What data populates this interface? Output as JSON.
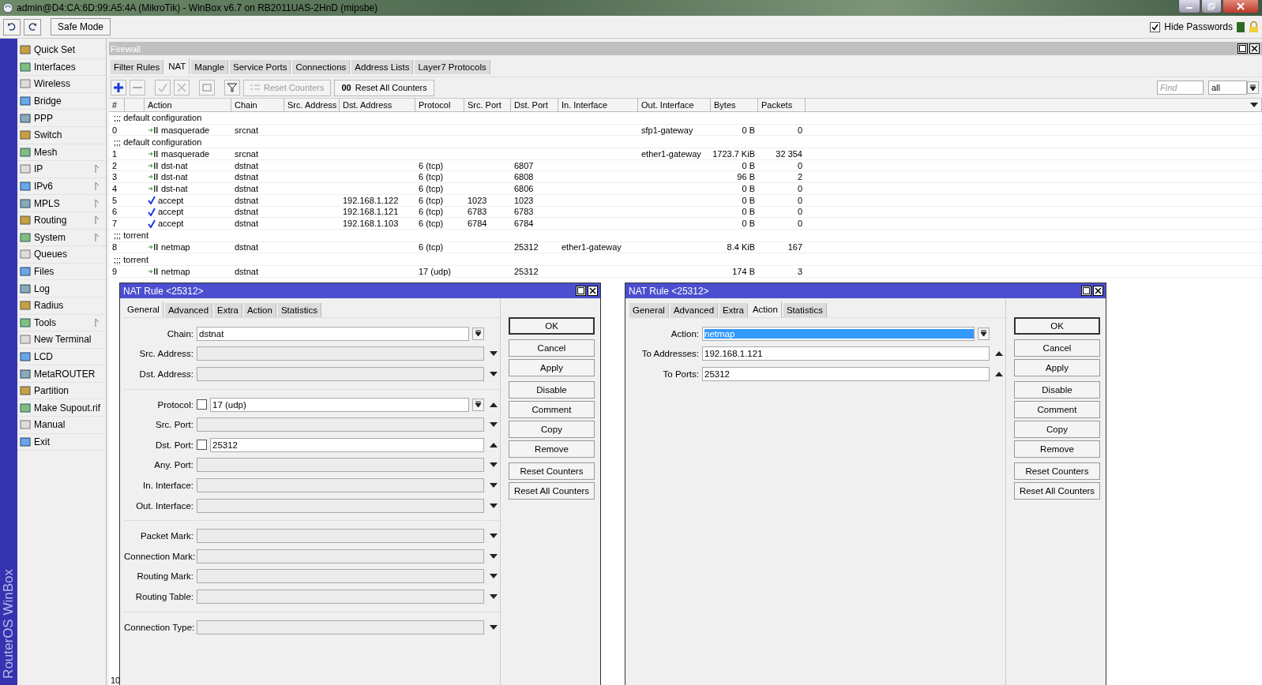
{
  "window": {
    "title": "admin@D4:CA:6D:99:A5:4A (MikroTik) - WinBox v6.7 on RB2011UAS-2HnD (mipsbe)"
  },
  "toolbar": {
    "safe_mode": "Safe Mode",
    "hide_passwords": {
      "label": "Hide Passwords",
      "checked": true
    }
  },
  "brand": "RouterOS WinBox",
  "sidebar": {
    "items": [
      {
        "label": "Quick Set",
        "submenu": false
      },
      {
        "label": "Interfaces",
        "submenu": false
      },
      {
        "label": "Wireless",
        "submenu": false
      },
      {
        "label": "Bridge",
        "submenu": false
      },
      {
        "label": "PPP",
        "submenu": false
      },
      {
        "label": "Switch",
        "submenu": false
      },
      {
        "label": "Mesh",
        "submenu": false
      },
      {
        "label": "IP",
        "submenu": true
      },
      {
        "label": "IPv6",
        "submenu": true
      },
      {
        "label": "MPLS",
        "submenu": true
      },
      {
        "label": "Routing",
        "submenu": true
      },
      {
        "label": "System",
        "submenu": true
      },
      {
        "label": "Queues",
        "submenu": false
      },
      {
        "label": "Files",
        "submenu": false
      },
      {
        "label": "Log",
        "submenu": false
      },
      {
        "label": "Radius",
        "submenu": false
      },
      {
        "label": "Tools",
        "submenu": true
      },
      {
        "label": "New Terminal",
        "submenu": false
      },
      {
        "label": "LCD",
        "submenu": false
      },
      {
        "label": "MetaROUTER",
        "submenu": false
      },
      {
        "label": "Partition",
        "submenu": false
      },
      {
        "label": "Make Supout.rif",
        "submenu": false
      },
      {
        "label": "Manual",
        "submenu": false
      },
      {
        "label": "Exit",
        "submenu": false
      }
    ]
  },
  "firewall": {
    "title": "Firewall",
    "tabs": [
      {
        "label": "Filter Rules",
        "selected": false
      },
      {
        "label": "NAT",
        "selected": true
      },
      {
        "label": "Mangle",
        "selected": false
      },
      {
        "label": "Service Ports",
        "selected": false
      },
      {
        "label": "Connections",
        "selected": false
      },
      {
        "label": "Address Lists",
        "selected": false
      },
      {
        "label": "Layer7 Protocols",
        "selected": false
      }
    ],
    "reset_counters": {
      "label": "Reset Counters",
      "disabled": true
    },
    "reset_all_counters": {
      "glyph": "00",
      "label": "Reset All Counters"
    },
    "find": {
      "placeholder": "Find"
    },
    "filter": {
      "value": "all"
    },
    "table": {
      "columns": [
        "#",
        "Action",
        "Chain",
        "Src. Address",
        "Dst. Address",
        "Protocol",
        "Src. Port",
        "Dst. Port",
        "In. Interface",
        "Out. Interface",
        "Bytes",
        "Packets"
      ],
      "rows": [
        {
          "kind": "comment",
          "text": ";;; default configuration"
        },
        {
          "kind": "rule",
          "number": "0",
          "action": "masquerade",
          "chain": "srcnat",
          "out_interface": "sfp1-gateway",
          "bytes": "0 B",
          "packets": "0"
        },
        {
          "kind": "comment",
          "text": ";;; default configuration"
        },
        {
          "kind": "rule",
          "number": "1",
          "action": "masquerade",
          "chain": "srcnat",
          "out_interface": "ether1-gateway",
          "bytes": "1723.7 KiB",
          "packets": "32 354"
        },
        {
          "kind": "rule",
          "number": "2",
          "action": "dst-nat",
          "chain": "dstnat",
          "protocol": "6 (tcp)",
          "dst_port": "6807",
          "bytes": "0 B",
          "packets": "0"
        },
        {
          "kind": "rule",
          "number": "3",
          "action": "dst-nat",
          "chain": "dstnat",
          "protocol": "6 (tcp)",
          "dst_port": "6808",
          "bytes": "96 B",
          "packets": "2"
        },
        {
          "kind": "rule",
          "number": "4",
          "action": "dst-nat",
          "chain": "dstnat",
          "protocol": "6 (tcp)",
          "dst_port": "6806",
          "bytes": "0 B",
          "packets": "0"
        },
        {
          "kind": "accept",
          "number": "5",
          "action": "accept",
          "chain": "dstnat",
          "dst_address": "192.168.1.122",
          "protocol": "6 (tcp)",
          "src_port": "1023",
          "dst_port": "1023",
          "bytes": "0 B",
          "packets": "0"
        },
        {
          "kind": "accept",
          "number": "6",
          "action": "accept",
          "chain": "dstnat",
          "dst_address": "192.168.1.121",
          "protocol": "6 (tcp)",
          "src_port": "6783",
          "dst_port": "6783",
          "bytes": "0 B",
          "packets": "0"
        },
        {
          "kind": "accept",
          "number": "7",
          "action": "accept",
          "chain": "dstnat",
          "dst_address": "192.168.1.103",
          "protocol": "6 (tcp)",
          "src_port": "6784",
          "dst_port": "6784",
          "bytes": "0 B",
          "packets": "0"
        },
        {
          "kind": "comment",
          "text": ";;; torrent"
        },
        {
          "kind": "rule",
          "number": "8",
          "action": "netmap",
          "chain": "dstnat",
          "protocol": "6 (tcp)",
          "dst_port": "25312",
          "in_interface": "ether1-gateway",
          "bytes": "8.4 KiB",
          "packets": "167"
        },
        {
          "kind": "comment",
          "text": ";;; torrent"
        },
        {
          "kind": "rule",
          "number": "9",
          "action": "netmap",
          "chain": "dstnat",
          "protocol": "17 (udp)",
          "dst_port": "25312",
          "bytes": "174 B",
          "packets": "3"
        }
      ]
    },
    "status": "10"
  },
  "dialogs": [
    {
      "title": "NAT Rule <25312>",
      "tabs": [
        {
          "label": "General",
          "selected": true
        },
        {
          "label": "Advanced",
          "selected": false
        },
        {
          "label": "Extra",
          "selected": false
        },
        {
          "label": "Action",
          "selected": false
        },
        {
          "label": "Statistics",
          "selected": false
        }
      ],
      "groups": [
        [
          {
            "label": "Chain:",
            "value": "dstnat",
            "kind": "combo"
          },
          {
            "label": "Src. Address:",
            "kind": "collapsed"
          },
          {
            "label": "Dst. Address:",
            "kind": "collapsed"
          }
        ],
        [
          {
            "label": "Protocol:",
            "value": "17 (udp)",
            "kind": "combo",
            "expanded": true,
            "checked": false
          },
          {
            "label": "Src. Port:",
            "kind": "collapsed"
          },
          {
            "label": "Dst. Port:",
            "value": "25312",
            "kind": "expanded",
            "checked": false
          },
          {
            "label": "Any. Port:",
            "kind": "collapsed"
          },
          {
            "label": "In. Interface:",
            "kind": "collapsed"
          },
          {
            "label": "Out. Interface:",
            "kind": "collapsed"
          }
        ],
        [
          {
            "label": "Packet Mark:",
            "kind": "collapsed"
          },
          {
            "label": "Connection Mark:",
            "kind": "collapsed"
          },
          {
            "label": "Routing Mark:",
            "kind": "collapsed"
          },
          {
            "label": "Routing Table:",
            "kind": "collapsed"
          }
        ],
        [
          {
            "label": "Connection Type:",
            "kind": "collapsed"
          }
        ]
      ],
      "buttons": [
        [
          "OK"
        ],
        [
          "Cancel",
          "Apply"
        ],
        [
          "Disable",
          "Comment",
          "Copy",
          "Remove"
        ],
        [
          "Reset Counters",
          "Reset All Counters"
        ]
      ]
    },
    {
      "title": "NAT Rule <25312>",
      "tabs": [
        {
          "label": "General",
          "selected": false
        },
        {
          "label": "Advanced",
          "selected": false
        },
        {
          "label": "Extra",
          "selected": false
        },
        {
          "label": "Action",
          "selected": true
        },
        {
          "label": "Statistics",
          "selected": false
        }
      ],
      "groups": [
        [
          {
            "label": "Action:",
            "value": "netmap",
            "kind": "combo",
            "highlighted": true
          },
          {
            "label": "To Addresses:",
            "value": "192.168.1.121",
            "kind": "expanded"
          },
          {
            "label": "To Ports:",
            "value": "25312",
            "kind": "expanded"
          }
        ]
      ],
      "buttons": [
        [
          "OK"
        ],
        [
          "Cancel",
          "Apply"
        ],
        [
          "Disable",
          "Comment",
          "Copy",
          "Remove"
        ],
        [
          "Reset Counters",
          "Reset All Counters"
        ]
      ]
    }
  ]
}
